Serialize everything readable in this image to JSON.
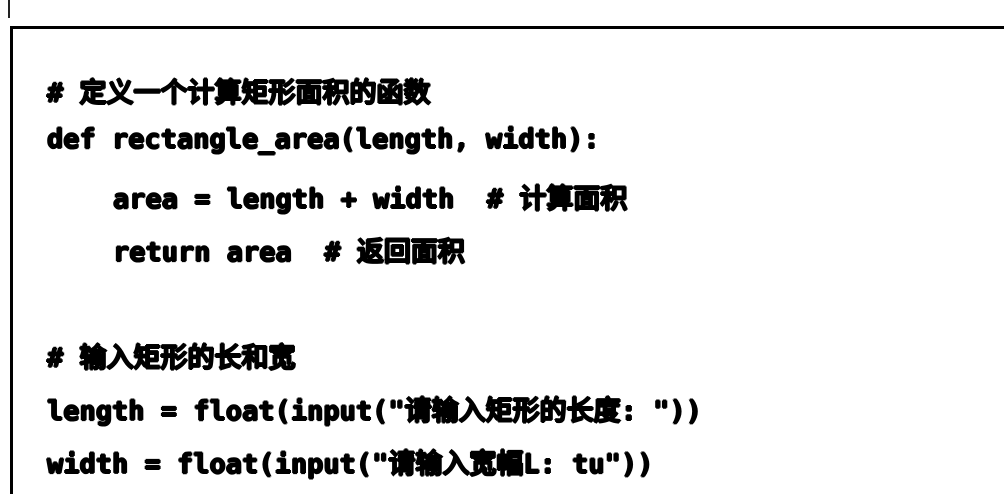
{
  "top_fragment": {
    "text": "\""
  },
  "code": {
    "lines": [
      "# 定义一个计算矩形面积的函数",
      "def rectangle_area(length, width):",
      "area = length + width  # 计算面积",
      "return area  # 返回面积",
      "",
      "# 输入矩形的长和宽",
      "length = float(input(\"请输入矩形的长度: \"))",
      "width = float(input(\"请输入宽幅L: tu\"))"
    ]
  }
}
